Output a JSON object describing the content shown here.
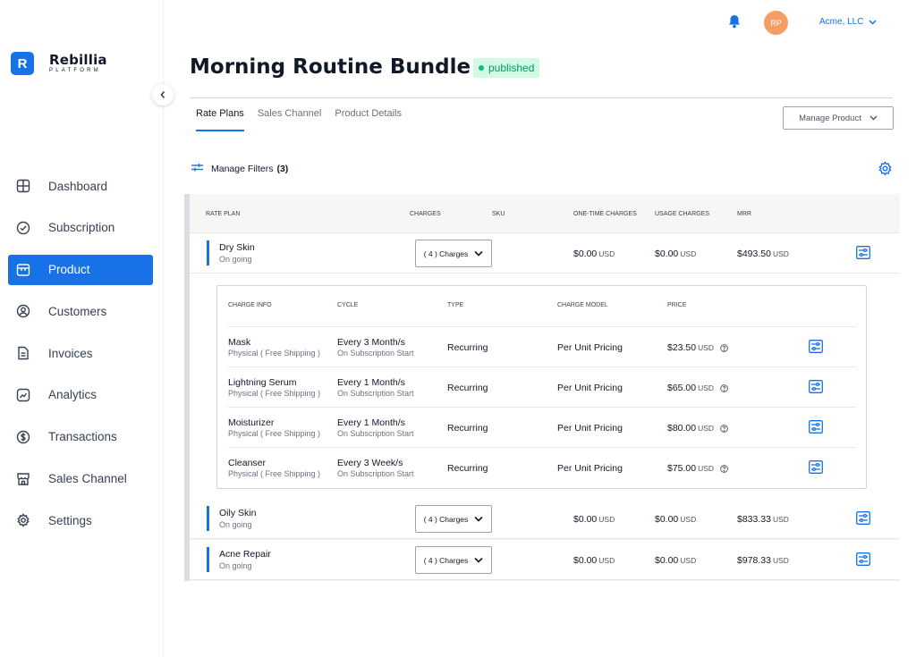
{
  "brand": {
    "logo_letter": "R",
    "name": "Rebillia",
    "sub": "PLATFORM"
  },
  "sidebar": {
    "items": [
      {
        "label": "Dashboard",
        "icon": "dashboard-icon"
      },
      {
        "label": "Subscription",
        "icon": "check-circle-icon"
      },
      {
        "label": "Product",
        "icon": "product-icon",
        "active": true
      },
      {
        "label": "Customers",
        "icon": "user-circle-icon"
      },
      {
        "label": "Invoices",
        "icon": "document-icon"
      },
      {
        "label": "Analytics",
        "icon": "analytics-icon"
      },
      {
        "label": "Transactions",
        "icon": "dollar-icon"
      },
      {
        "label": "Sales Channel",
        "icon": "store-icon"
      },
      {
        "label": "Settings",
        "icon": "gear-icon"
      }
    ]
  },
  "topbar": {
    "avatar_initials": "RP",
    "account_name": "Acme, LLC"
  },
  "page": {
    "title": "Morning Routine Bundle",
    "status": "published",
    "tabs": [
      "Rate Plans",
      "Sales Channel",
      "Product Details"
    ],
    "manage_product_label": "Manage Product",
    "filters_label": "Manage Filters",
    "filters_count": "(3)"
  },
  "table": {
    "headers": [
      "RATE PLAN",
      "CHARGES",
      "SKU",
      "ONE-TIME CHARGES",
      "USAGE CHARGES",
      "MRR"
    ],
    "rows": [
      {
        "name": "Dry Skin",
        "status": "On going",
        "charges": "( 4 ) Charges",
        "one_time": "$0.00",
        "usage": "$0.00",
        "mrr": "$493.50",
        "currency": "USD"
      },
      {
        "name": "Oily Skin",
        "status": "On going",
        "charges": "( 4 ) Charges",
        "one_time": "$0.00",
        "usage": "$0.00",
        "mrr": "$833.33",
        "currency": "USD"
      },
      {
        "name": "Acne Repair",
        "status": "On going",
        "charges": "( 4 ) Charges",
        "one_time": "$0.00",
        "usage": "$0.00",
        "mrr": "$978.33",
        "currency": "USD"
      }
    ]
  },
  "charges": {
    "headers": [
      "CHARGE INFO",
      "CYCLE",
      "TYPE",
      "CHARGE MODEL",
      "PRICE"
    ],
    "rows": [
      {
        "name": "Mask",
        "detail": "Physical ( Free Shipping )",
        "cycle": "Every 3 Month/s",
        "cycle_start": "On Subscription Start",
        "type": "Recurring",
        "model": "Per Unit Pricing",
        "price": "$23.50",
        "currency": "USD"
      },
      {
        "name": "Lightning Serum",
        "detail": "Physical ( Free Shipping )",
        "cycle": "Every 1 Month/s",
        "cycle_start": "On Subscription Start",
        "type": "Recurring",
        "model": "Per Unit Pricing",
        "price": "$65.00",
        "currency": "USD"
      },
      {
        "name": "Moisturizer",
        "detail": "Physical ( Free Shipping )",
        "cycle": "Every 1 Month/s",
        "cycle_start": "On Subscription Start",
        "type": "Recurring",
        "model": "Per Unit Pricing",
        "price": "$80.00",
        "currency": "USD"
      },
      {
        "name": "Cleanser",
        "detail": "Physical ( Free Shipping )",
        "cycle": "Every 3 Week/s",
        "cycle_start": "On Subscription Start",
        "type": "Recurring",
        "model": "Per Unit Pricing",
        "price": "$75.00",
        "currency": "USD"
      }
    ]
  },
  "colors": {
    "accent": "#1672e6",
    "status_bg": "#d1fae5",
    "status_text": "#059669",
    "avatar": "#f59e63"
  }
}
